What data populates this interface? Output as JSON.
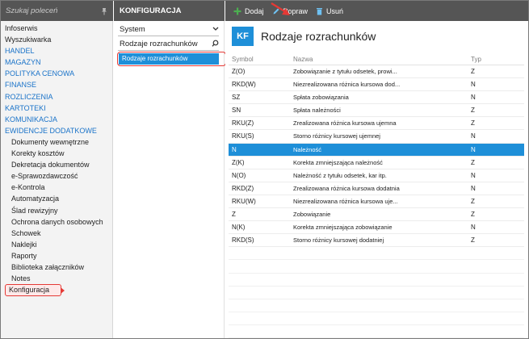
{
  "colors": {
    "accent": "#1e8fd8",
    "header_bg": "#555555",
    "highlight_red": "#e53935",
    "category_blue": "#1a73c9"
  },
  "nav": {
    "search_placeholder": "Szukaj poleceń",
    "pin_icon": "pin-icon",
    "items": [
      {
        "label": "Infoserwis",
        "type": "plain"
      },
      {
        "label": "Wyszukiwarka",
        "type": "plain"
      },
      {
        "label": "HANDEL",
        "type": "cat"
      },
      {
        "label": "MAGAZYN",
        "type": "cat"
      },
      {
        "label": "POLITYKA CENOWA",
        "type": "cat"
      },
      {
        "label": "FINANSE",
        "type": "cat"
      },
      {
        "label": "ROZLICZENIA",
        "type": "cat"
      },
      {
        "label": "KARTOTEKI",
        "type": "cat"
      },
      {
        "label": "KOMUNIKACJA",
        "type": "cat"
      },
      {
        "label": "EWIDENCJE DODATKOWE",
        "type": "cat"
      },
      {
        "label": "Dokumenty wewnętrzne",
        "type": "sub"
      },
      {
        "label": "Korekty kosztów",
        "type": "sub"
      },
      {
        "label": "Dekretacja dokumentów",
        "type": "sub"
      },
      {
        "label": "e-Sprawozdawczość",
        "type": "sub"
      },
      {
        "label": "e-Kontrola",
        "type": "sub"
      },
      {
        "label": "Automatyzacja",
        "type": "sub"
      },
      {
        "label": "Ślad rewizyjny",
        "type": "sub"
      },
      {
        "label": "Ochrona danych osobowych",
        "type": "sub"
      },
      {
        "label": "Schowek",
        "type": "sub"
      },
      {
        "label": "Naklejki",
        "type": "sub"
      },
      {
        "label": "Raporty",
        "type": "sub"
      },
      {
        "label": "Biblioteka załączników",
        "type": "sub"
      },
      {
        "label": "Notes",
        "type": "sub"
      },
      {
        "label": "Konfiguracja",
        "type": "sel"
      }
    ]
  },
  "mid": {
    "header": "KONFIGURACJA",
    "select_value": "System",
    "search_value": "Rodzaje rozrachunków",
    "selected_item": "Rodzaje rozrachunków"
  },
  "toolbar": {
    "add_label": "Dodaj",
    "edit_label": "Popraw",
    "delete_label": "Usuń"
  },
  "content": {
    "badge": "KF",
    "title": "Rodzaje rozrachunków",
    "columns": [
      "Symbol",
      "Nazwa",
      "Typ"
    ],
    "rows": [
      {
        "symbol": "Z(O)",
        "name": "Zobowiązanie z tytułu odsetek, prowi...",
        "type": "Z",
        "active": false
      },
      {
        "symbol": "RKD(W)",
        "name": "Niezrealizowana różnica kursowa dod...",
        "type": "N",
        "active": false
      },
      {
        "symbol": "SZ",
        "name": "Spłata zobowiązania",
        "type": "N",
        "active": false
      },
      {
        "symbol": "SN",
        "name": "Spłata należności",
        "type": "Z",
        "active": false
      },
      {
        "symbol": "RKU(Z)",
        "name": "Zrealizowana różnica kursowa ujemna",
        "type": "Z",
        "active": false
      },
      {
        "symbol": "RKU(S)",
        "name": "Storno różnicy kursowej ujemnej",
        "type": "N",
        "active": false
      },
      {
        "symbol": "N",
        "name": "Należność",
        "type": "N",
        "active": true
      },
      {
        "symbol": "Z(K)",
        "name": "Korekta zmniejszająca należność",
        "type": "Z",
        "active": false
      },
      {
        "symbol": "N(O)",
        "name": "Należność z tytułu odsetek, kar itp.",
        "type": "N",
        "active": false
      },
      {
        "symbol": "RKD(Z)",
        "name": "Zrealizowana różnica kursowa dodatnia",
        "type": "N",
        "active": false
      },
      {
        "symbol": "RKU(W)",
        "name": "Niezrealizowana różnica kursowa uje...",
        "type": "Z",
        "active": false
      },
      {
        "symbol": "Z",
        "name": "Zobowiązanie",
        "type": "Z",
        "active": false
      },
      {
        "symbol": "N(K)",
        "name": "Korekta zmniejszająca zobowiązanie",
        "type": "N",
        "active": false
      },
      {
        "symbol": "RKD(S)",
        "name": "Storno różnicy kursowej dodatniej",
        "type": "Z",
        "active": false
      }
    ]
  }
}
